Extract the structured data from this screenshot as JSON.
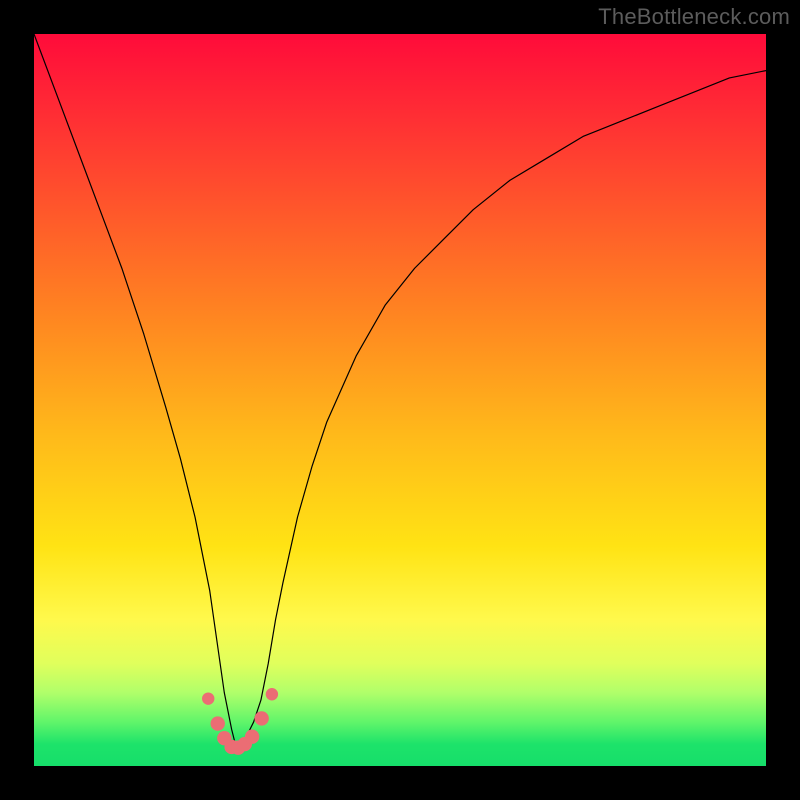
{
  "watermark": "TheBottleneck.com",
  "chart_data": {
    "type": "line",
    "title": "",
    "xlabel": "",
    "ylabel": "",
    "xlim": [
      0,
      100
    ],
    "ylim": [
      0,
      100
    ],
    "grid": false,
    "series": [
      {
        "name": "bottleneck-curve",
        "x": [
          0,
          3,
          6,
          9,
          12,
          15,
          18,
          20,
          22,
          24,
          25,
          26,
          27,
          27.5,
          28,
          28.5,
          29,
          30,
          31,
          32,
          33,
          34,
          36,
          38,
          40,
          44,
          48,
          52,
          56,
          60,
          65,
          70,
          75,
          80,
          85,
          90,
          95,
          100
        ],
        "values": [
          100,
          92,
          84,
          76,
          68,
          59,
          49,
          42,
          34,
          24,
          17,
          10,
          5,
          3,
          2.5,
          3,
          4,
          6,
          9,
          14,
          20,
          25,
          34,
          41,
          47,
          56,
          63,
          68,
          72,
          76,
          80,
          83,
          86,
          88,
          90,
          92,
          94,
          95
        ]
      }
    ],
    "markers": {
      "name": "highlight-points",
      "color": "#eb6d74",
      "x": [
        23.8,
        25.1,
        26.0,
        27.0,
        27.9,
        28.8,
        29.8,
        31.1,
        32.5
      ],
      "values": [
        9.2,
        5.8,
        3.8,
        2.6,
        2.5,
        3.0,
        4.0,
        6.5,
        9.8
      ]
    }
  }
}
